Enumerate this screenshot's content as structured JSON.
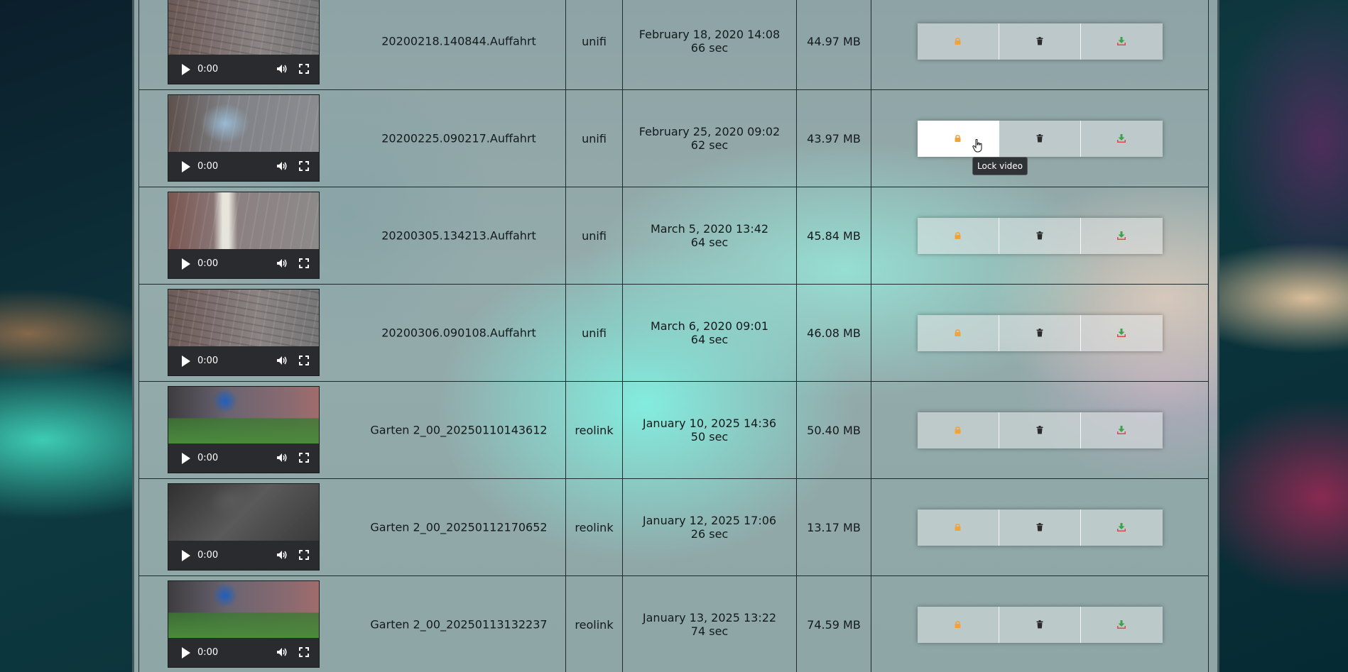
{
  "tooltip": "Lock video",
  "colors": {
    "lock": "#f2a23a",
    "trash": "#2b2b2b",
    "download_arrow": "#3aa24a",
    "download_tray": "#e04848"
  },
  "icons": {
    "lock": "lock-icon",
    "delete": "trash-icon",
    "download": "download-icon",
    "play": "play-icon",
    "volume": "volume-icon",
    "fullscreen": "fullscreen-icon"
  },
  "rows": [
    {
      "time": "0:00",
      "name": "20200218.140844.Auffahrt",
      "source": "unifi",
      "date": "February 18, 2020 14:08",
      "duration": "66 sec",
      "size": "44.97 MB"
    },
    {
      "time": "0:00",
      "name": "20200225.090217.Auffahrt",
      "source": "unifi",
      "date": "February 25, 2020 09:02",
      "duration": "62 sec",
      "size": "43.97 MB"
    },
    {
      "time": "0:00",
      "name": "20200305.134213.Auffahrt",
      "source": "unifi",
      "date": "March 5, 2020 13:42",
      "duration": "64 sec",
      "size": "45.84 MB"
    },
    {
      "time": "0:00",
      "name": "20200306.090108.Auffahrt",
      "source": "unifi",
      "date": "March 6, 2020 09:01",
      "duration": "64 sec",
      "size": "46.08 MB"
    },
    {
      "time": "0:00",
      "name": "Garten 2_00_20250110143612",
      "source": "reolink",
      "date": "January 10, 2025 14:36",
      "duration": "50 sec",
      "size": "50.40 MB"
    },
    {
      "time": "0:00",
      "name": "Garten 2_00_20250112170652",
      "source": "reolink",
      "date": "January 12, 2025 17:06",
      "duration": "26 sec",
      "size": "13.17 MB"
    },
    {
      "time": "0:00",
      "name": "Garten 2_00_20250113132237",
      "source": "reolink",
      "date": "January 13, 2025 13:22",
      "duration": "74 sec",
      "size": "74.59 MB"
    }
  ]
}
